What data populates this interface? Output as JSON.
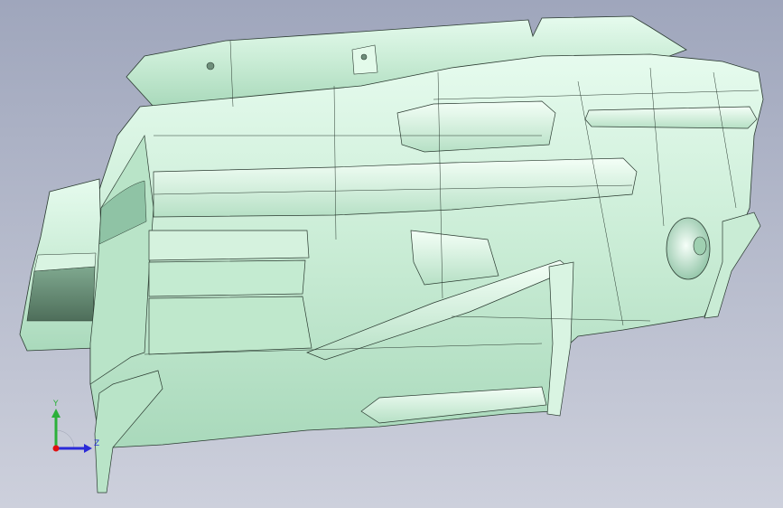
{
  "viewport": {
    "background_top": "#9fa6bc",
    "background_bottom": "#cdd0dc"
  },
  "model": {
    "surface_color": "#c9ecd5",
    "surface_highlight": "#eefcf2",
    "surface_shadow": "#8fc3a5",
    "edge_color": "#2a3a30"
  },
  "triad": {
    "y_label": "Y",
    "z_label": "Z",
    "y_color": "#2bb03a",
    "z_color": "#2a2ad8",
    "origin_color": "#e01010"
  }
}
